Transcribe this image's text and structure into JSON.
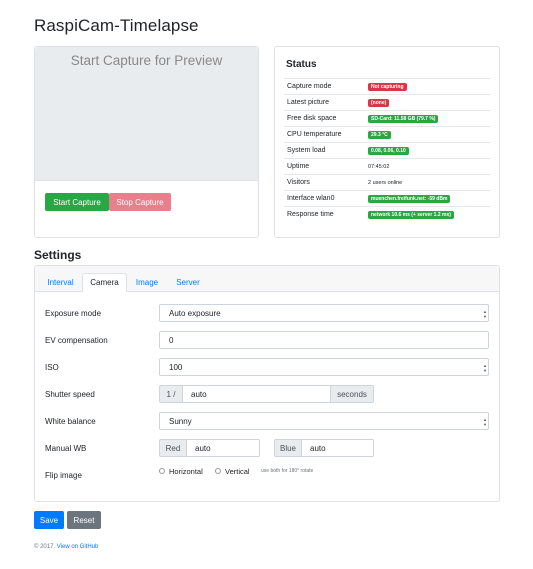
{
  "app": {
    "title": "RaspiCam-Timelapse"
  },
  "preview": {
    "placeholder": "Start Capture for Preview",
    "start_label": "Start Capture",
    "stop_label": "Stop Capture"
  },
  "status": {
    "title": "Status",
    "rows": [
      {
        "label": "Capture mode",
        "value": "Not capturing",
        "style": "danger"
      },
      {
        "label": "Latest picture",
        "value": "(none)",
        "style": "danger"
      },
      {
        "label": "Free disk space",
        "value": "SD-Card: 11.58 GB (79.7 %)",
        "style": "success"
      },
      {
        "label": "CPU temperature",
        "value": "29.3 °C",
        "style": "success"
      },
      {
        "label": "System load",
        "value": "0.08, 0.06, 0.10",
        "style": "success"
      },
      {
        "label": "Uptime",
        "value": "07:45:02",
        "style": "plain"
      },
      {
        "label": "Visitors",
        "value": "2 users online",
        "style": "plain"
      },
      {
        "label": "Interface wlan0",
        "value": "muenchen.freifunk.net: -59 dBm",
        "style": "success"
      },
      {
        "label": "Response time",
        "value": "network 10.6 ms (+ server 1.2 ms)",
        "style": "success"
      }
    ],
    "colors": {
      "danger": "#dc3545",
      "success": "#28a745"
    }
  },
  "settings": {
    "title": "Settings",
    "tabs": [
      "Interval",
      "Camera",
      "Image",
      "Server"
    ],
    "active_tab": "Camera",
    "exposure_mode": {
      "label": "Exposure mode",
      "value": "Auto exposure"
    },
    "ev_compensation": {
      "label": "EV compensation",
      "value": "0"
    },
    "iso": {
      "label": "ISO",
      "value": "100"
    },
    "shutter_speed": {
      "label": "Shutter speed",
      "prefix": "1 /",
      "value": "auto",
      "suffix": "seconds"
    },
    "white_balance": {
      "label": "White balance",
      "value": "Sunny"
    },
    "manual_wb": {
      "label": "Manual WB",
      "red_label": "Red",
      "red_value": "auto",
      "blue_label": "Blue",
      "blue_value": "auto"
    },
    "flip_image": {
      "label": "Flip image",
      "horizontal": "Horizontal",
      "vertical": "Vertical",
      "hint": "use both for 180° rotate"
    }
  },
  "actions": {
    "save_label": "Save",
    "reset_label": "Reset"
  },
  "footer": {
    "copyright": "© 2017.",
    "link_text": "View on GitHub"
  },
  "theme": {
    "primary": "#007bff",
    "success": "#28a745",
    "danger": "#dc3545",
    "secondary": "#6c757d"
  }
}
